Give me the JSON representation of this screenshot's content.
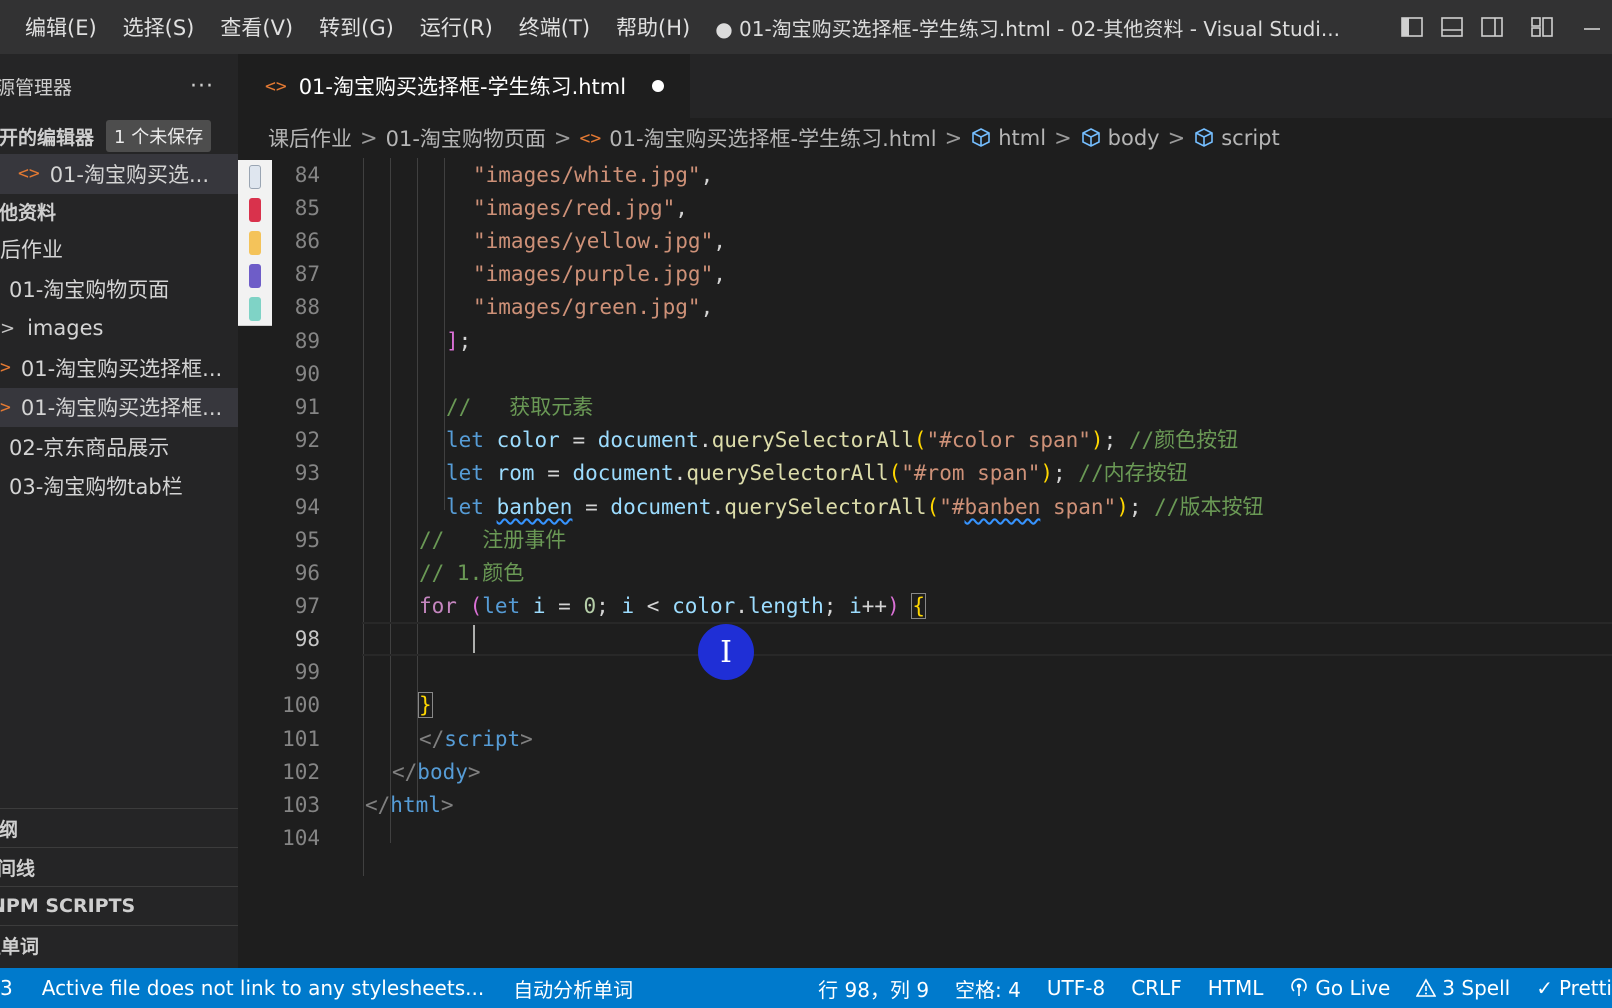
{
  "titlebar": {
    "menus": [
      "编辑(E)",
      "选择(S)",
      "查看(V)",
      "转到(G)",
      "运行(R)",
      "终端(T)",
      "帮助(H)"
    ],
    "window_title": "● 01-淘宝购买选择框-学生练习.html - 02-其他资料 - Visual Studi..."
  },
  "sidebar": {
    "title": "源管理器",
    "more": "···",
    "open_editors": {
      "label": "打开的编辑器",
      "badge": "1 个未保存"
    },
    "open_file": "01-淘宝购买选...",
    "workspace": "其他资料",
    "tree": [
      {
        "label": "课后作业"
      },
      {
        "label": "01-淘宝购物页面"
      },
      {
        "label": "images"
      },
      {
        "label": "01-淘宝购买选择框..."
      },
      {
        "label": "01-淘宝购买选择框..."
      },
      {
        "label": "02-京东商品展示"
      },
      {
        "label": "03-淘宝购物tab栏"
      }
    ],
    "bottom_sections": [
      "大纲",
      "时间线",
      "NPM SCRIPTS",
      "生单词"
    ]
  },
  "editor": {
    "tab_title": "01-淘宝购买选择框-学生练习.html",
    "breadcrumb": {
      "folder1": "课后作业",
      "folder2": "01-淘宝购物页面",
      "file": "01-淘宝购买选择框-学生练习.html",
      "sym1": "html",
      "sym2": "body",
      "sym3": "script"
    },
    "line_numbers": [
      "84",
      "85",
      "86",
      "87",
      "88",
      "89",
      "90",
      "91",
      "92",
      "93",
      "94",
      "95",
      "96",
      "97",
      "98",
      "99",
      "100",
      "101",
      "102",
      "103",
      "104"
    ],
    "cursor_line": "98",
    "thumb_colors": [
      "#e8eef5",
      "#d9324c",
      "#f4c35a",
      "#6e5dc8",
      "#7fd3c6"
    ],
    "code": {
      "l84": "\"images/white.jpg\"",
      "l85": "\"images/red.jpg\"",
      "l86": "\"images/yellow.jpg\"",
      "l87": "\"images/purple.jpg\"",
      "l88": "\"images/green.jpg\"",
      "l91": "//   获取元素",
      "l92_kw": "let",
      "l92_var": "color",
      "l92_obj": "document",
      "l92_fn": "querySelectorAll",
      "l92_str": "\"#color span\"",
      "l92_cm": "//颜色按钮",
      "l93_kw": "let",
      "l93_var": "rom",
      "l93_obj": "document",
      "l93_fn": "querySelectorAll",
      "l93_str": "\"#rom span\"",
      "l93_cm": "//内存按钮",
      "l94_kw": "let",
      "l94_var": "banben",
      "l94_obj": "document",
      "l94_fn": "querySelectorAll",
      "l94_str1": "\"#",
      "l94_str2": "banben",
      "l94_str3": " span\"",
      "l94_cm": "//版本按钮",
      "l95": "//   注册事件",
      "l96": "// 1.颜色",
      "l97_for": "for",
      "l97_let": "let",
      "l97_i": "i",
      "l97_zero": "0",
      "l97_i2": "i",
      "l97_color": "color",
      "l97_length": "length",
      "l97_i3": "i",
      "l101_tag": "script",
      "l102_tag": "body",
      "l103_tag": "html"
    },
    "mouse_glyph": "I"
  },
  "statusbar": {
    "problems": "3",
    "message": "Active file does not link to any stylesheets...",
    "analyze": "自动分析单词",
    "position": "行 98，列 9",
    "spaces": "空格: 4",
    "encoding": "UTF-8",
    "eol": "CRLF",
    "language": "HTML",
    "golive": "Go Live",
    "spell": "3 Spell",
    "prettier": "Pretti"
  }
}
